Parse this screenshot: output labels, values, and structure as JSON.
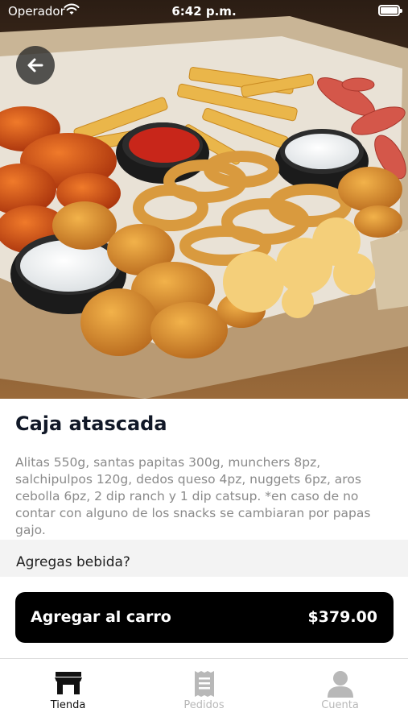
{
  "status_bar": {
    "carrier": "Operador",
    "time": "6:42 p.m."
  },
  "product": {
    "name": "Caja atascada",
    "description": "Alitas 550g, santas papitas 300g, munchers 8pz, salchipulpos 120g, dedos queso 4pz, nuggets 6pz, aros cebolla 6pz, 2 dip ranch y 1 dip catsup. *en caso de no contar con alguno de los snacks se cambiaran por papas gajo."
  },
  "extras": {
    "drink_prompt": "Agregas bebida?"
  },
  "cart_button": {
    "label": "Agregar al carro",
    "price": "$379.00"
  },
  "tabs": [
    {
      "label": "Tienda",
      "icon": "store-icon",
      "active": true
    },
    {
      "label": "Pedidos",
      "icon": "receipt-icon",
      "active": false
    },
    {
      "label": "Cuenta",
      "icon": "user-icon",
      "active": false
    }
  ],
  "colors": {
    "primary": "#000000",
    "text_dark": "#111827",
    "text_muted": "#8a8a8a",
    "tab_inactive": "#b8b8b8",
    "band": "#f3f3f3"
  }
}
